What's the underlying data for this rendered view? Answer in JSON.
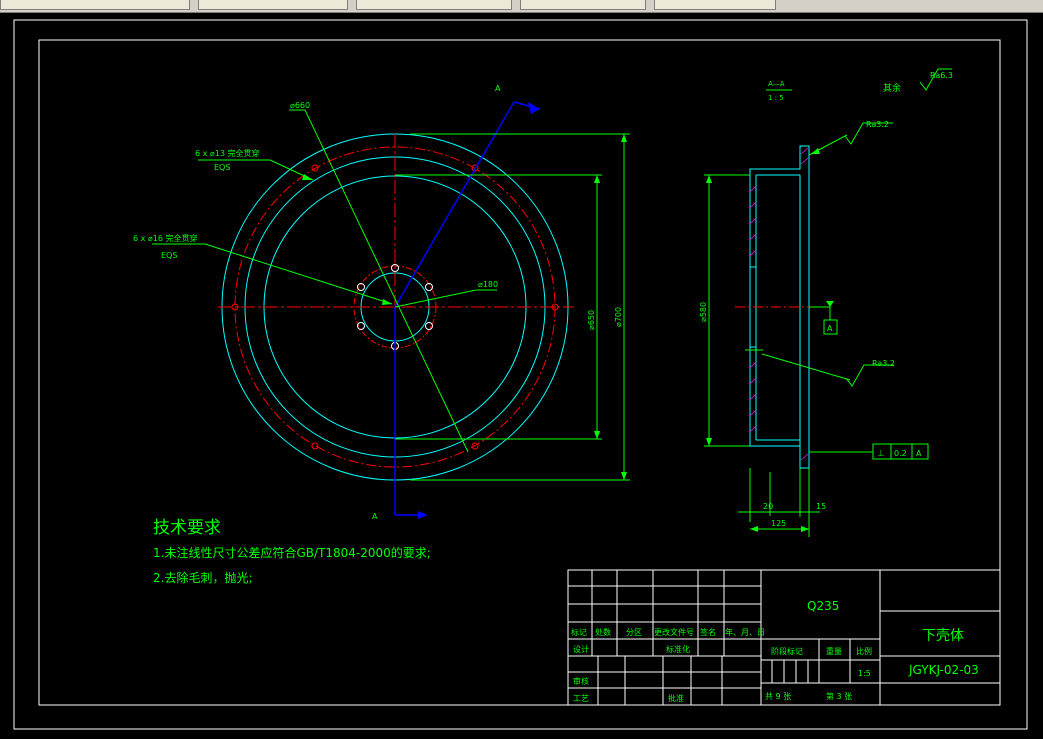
{
  "tabs": [
    {
      "label": ""
    },
    {
      "label": ""
    },
    {
      "label": ""
    },
    {
      "label": ""
    },
    {
      "label": ""
    }
  ],
  "colors": {
    "background": "#000000",
    "frame": "#ffffff",
    "outline": "#00ffff",
    "dimension": "#00ff00",
    "centerline": "#ff0000",
    "blue": "#0000ff",
    "hatch": "#ff00ff"
  },
  "drawing": {
    "hole_note_1_line1": "6 x ⌀13 完全贯穿",
    "hole_note_1_line2": "EQS",
    "hole_note_2_line1": "6 x ⌀16 完全贯穿",
    "hole_note_2_line2": "EQS",
    "dim_660": "⌀660",
    "dim_180": "⌀180",
    "dim_650": "⌀650",
    "dim_700": "⌀700",
    "dim_580": "⌀580",
    "section_mark_top": "A",
    "section_mark_bottom": "A",
    "section_title_top": "A—A",
    "section_title_scale": "1 : 5",
    "roughness_other": "其余",
    "roughness_1": "Ra6.3",
    "roughness_2": "Ra3.2",
    "roughness_3": "Ra3.2",
    "datum": "A",
    "perp_symbol": "⊥",
    "perp_value": "0.2",
    "perp_datum": "A",
    "dim_20": "20",
    "dim_15": "15",
    "dim_125": "125"
  },
  "requirements": {
    "title": "技术要求",
    "item1": "1.未注线性尺寸公差应符合GB/T1804-2000的要求;",
    "item2": "2.去除毛刺，抛光;"
  },
  "title_block": {
    "material": "Q235",
    "part_name": "下壳体",
    "drawing_no": "JGYKJ-02-03",
    "h_mark": "标记",
    "h_count": "处数",
    "h_zone": "分区",
    "h_docno": "更改文件号",
    "h_sign": "签名",
    "h_date": "年、月、日",
    "r_design": "设计",
    "r_standard": "标准化",
    "r_check": "审核",
    "r_process": "工艺",
    "r_approve": "批准",
    "stage_label": "阶段标记",
    "weight_label": "重量",
    "scale_label": "比例",
    "scale_value": "1:5",
    "sheets_total": "共  9  张",
    "sheet_no": "第  3  张"
  }
}
